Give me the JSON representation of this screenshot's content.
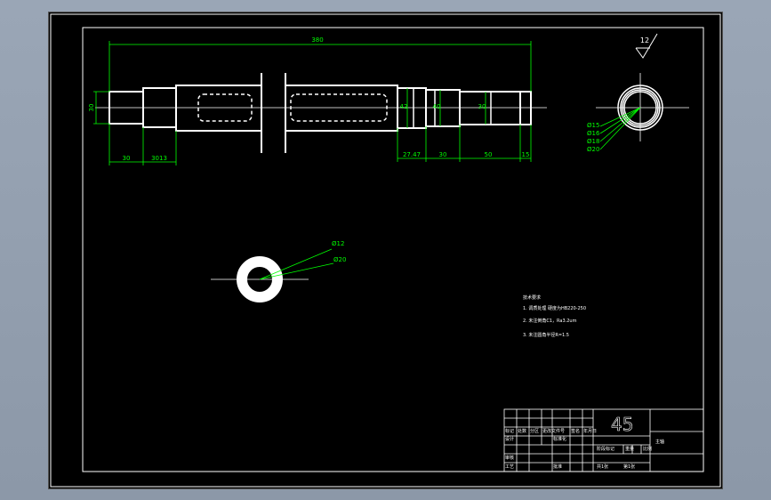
{
  "drawing": {
    "roughness_symbol": "12",
    "material": "45",
    "part_name": "主轴",
    "drawing_code": "",
    "scale": "1:1",
    "sheet": "共 1 张  第 1 张"
  },
  "dimensions": {
    "overall_length": "380",
    "left_dia": "30",
    "bottom_left": [
      "30",
      "3013"
    ],
    "bottom_right": [
      "27.47",
      "30",
      "50",
      "15"
    ],
    "dia_labels": [
      "42",
      "40",
      "30"
    ],
    "section_right_labels": [
      "Ø15",
      "Ø16",
      "Ø18",
      "Ø20"
    ],
    "section_left_labels": [
      "Ø12",
      "Ø20"
    ]
  },
  "tech_notes": {
    "title": "技术要求",
    "items": [
      "1. 调质处理 硬度为HB220-250",
      "2. 未注倒角C1，Ra3.2um",
      "3. 未注圆角半径R=1.5"
    ]
  },
  "title_block": {
    "header_row": [
      "标记",
      "处数",
      "分区",
      "更改文件号",
      "签名",
      "年月日"
    ],
    "design_row": [
      "设计",
      "",
      "标准化",
      ""
    ],
    "review_row": [
      "审核",
      "",
      "",
      ""
    ],
    "process_row": [
      "工艺",
      "",
      "批准",
      ""
    ],
    "stage_labels": [
      "阶段标记",
      "重量",
      "比例"
    ],
    "sheet_labels": [
      "共1张",
      "第1张"
    ]
  },
  "colors": {
    "geometry": "#ffffff",
    "dimension": "#00ff00",
    "background": "#000000"
  }
}
